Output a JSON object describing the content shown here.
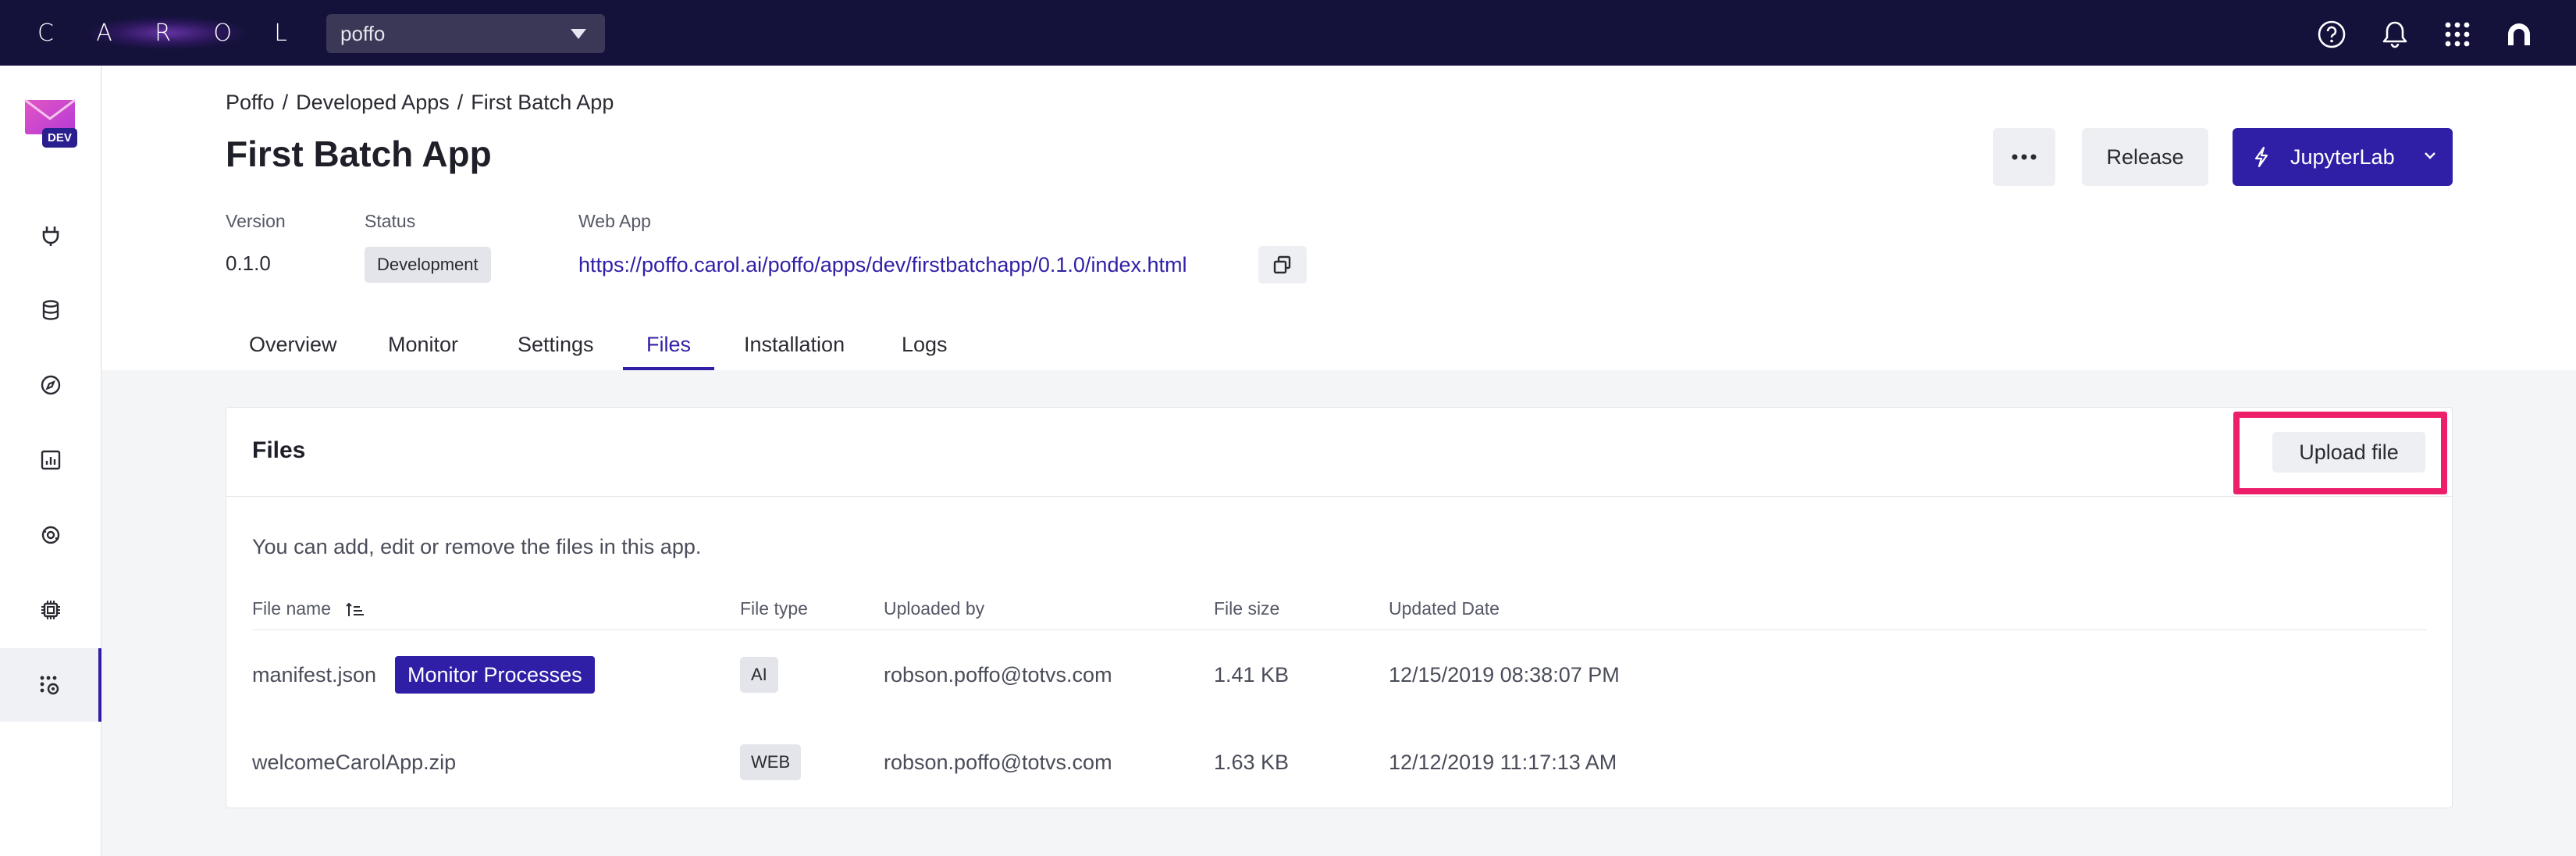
{
  "topbar": {
    "logo_letters": [
      "C",
      "A",
      "R",
      "O",
      "L"
    ],
    "env_select_value": "poffo",
    "icons": [
      "help-icon",
      "bell-icon",
      "apps-grid-icon",
      "user-avatar-icon"
    ]
  },
  "sidebar": {
    "badge": "DEV",
    "items": [
      {
        "icon": "plug-icon"
      },
      {
        "icon": "database-icon"
      },
      {
        "icon": "compass-icon"
      },
      {
        "icon": "chart-icon"
      },
      {
        "icon": "sync-icon"
      },
      {
        "icon": "chip-icon"
      },
      {
        "icon": "apps-settings-icon",
        "active": true
      }
    ]
  },
  "header": {
    "breadcrumb": [
      "Poffo",
      "Developed Apps",
      "First Batch App"
    ],
    "breadcrumb_sep": "/",
    "title": "First Batch App",
    "version_label": "Version",
    "version_value": "0.1.0",
    "status_label": "Status",
    "status_value": "Development",
    "webapp_label": "Web App",
    "webapp_url": "https://poffo.carol.ai/poffo/apps/dev/firstbatchapp/0.1.0/index.html",
    "release_label": "Release",
    "jupyter_label": "JupyterLab"
  },
  "tabs": [
    {
      "label": "Overview"
    },
    {
      "label": "Monitor"
    },
    {
      "label": "Settings"
    },
    {
      "label": "Files",
      "active": true
    },
    {
      "label": "Installation"
    },
    {
      "label": "Logs"
    }
  ],
  "files_card": {
    "title": "Files",
    "upload_label": "Upload file",
    "description": "You can add, edit or remove the files in this app.",
    "columns": [
      "File name",
      "File type",
      "Uploaded by",
      "File size",
      "Updated Date"
    ],
    "rows": [
      {
        "name": "manifest.json",
        "tag": "Monitor Processes",
        "type": "AI",
        "uploaded_by": "robson.poffo@totvs.com",
        "size": "1.41 KB",
        "updated": "12/15/2019 08:38:07 PM"
      },
      {
        "name": "welcomeCarolApp.zip",
        "type": "WEB",
        "uploaded_by": "robson.poffo@totvs.com",
        "size": "1.63 KB",
        "updated": "12/12/2019 11:17:13 AM"
      }
    ]
  },
  "colors": {
    "topbar_bg": "#14123a",
    "primary": "#2f1fa6",
    "highlight": "#ee1f6a"
  }
}
